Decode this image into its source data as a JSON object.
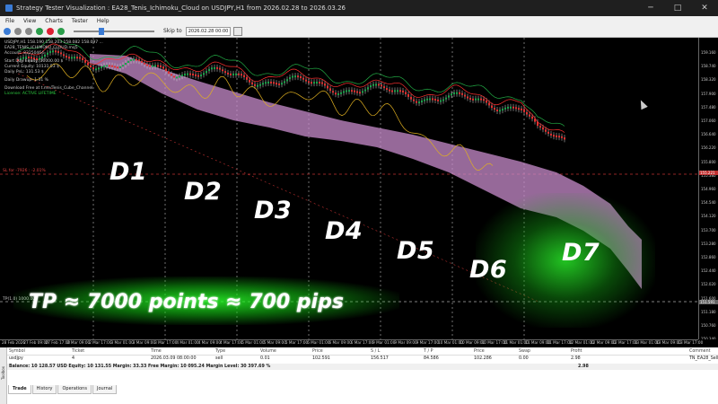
{
  "window": {
    "title": "Strategy Tester Visualization : EA28_Tenis_Ichimoku_Cloud on USDJPY,H1 from 2026.02.28 to 2026.03.26",
    "controls": [
      "─",
      "□",
      "✕"
    ]
  },
  "menu": [
    "File",
    "View",
    "Charts",
    "Tester",
    "Help"
  ],
  "toolbar": {
    "skip_label": "Skip to",
    "skip_date": "2026.02.28 00:00"
  },
  "overlay": {
    "lines": [
      "USDJPY,H1  158.190 158.203 158.082 158.097  ...",
      "EA28_TENIS_ICHIMOKU_CLOUD.mq5",
      "Account: 83250464",
      "",
      "Start Day Equity: 10000.00 $",
      "Current Equity: 10131.53 $",
      "Daily PnL: 131.53 $",
      "",
      "Daily Drawup: 1.31 %",
      "",
      "Download Free at t.me/Tenis_Cube_Channel",
      "License: ACTIVE LIFETIME"
    ],
    "sl_label": "SL for -7926 : -2.01%",
    "tp_line_label": "TP(1.0) 1000.00"
  },
  "price_scale": [
    "159.160",
    "158.740",
    "158.320",
    "157.900",
    "157.480",
    "157.060",
    "156.640",
    "156.220",
    "155.800",
    "155.380",
    "154.960",
    "154.540",
    "154.120",
    "153.700",
    "153.280",
    "152.860",
    "152.440",
    "152.020",
    "151.600",
    "151.180",
    "150.760",
    "150.340"
  ],
  "price_highlight": [
    "155.221",
    "151.591"
  ],
  "time_scale": [
    "28 Feb 2026",
    "27 Feb 09:00",
    "27 Feb 17:00",
    "2 Mar 09:00",
    "2 Mar 17:00",
    "3 Mar 01:00",
    "3 Mar 09:00",
    "3 Mar 17:00",
    "4 Mar 01:00",
    "4 Mar 09:00",
    "4 Mar 17:00",
    "5 Mar 01:00",
    "5 Mar 09:00",
    "5 Mar 17:00",
    "6 Mar 01:00",
    "6 Mar 09:00",
    "6 Mar 17:00",
    "9 Mar 01:00",
    "9 Mar 09:00",
    "9 Mar 17:00",
    "10 Mar 01:00",
    "10 Mar 09:00",
    "10 Mar 17:00",
    "11 Mar 01:00",
    "11 Mar 09:00",
    "11 Mar 17:00",
    "12 Mar 01:00",
    "12 Mar 09:00",
    "12 Mar 17:00",
    "13 Mar 01:00",
    "13 Mar 09:00",
    "13 Mar 17:00"
  ],
  "day_labels": [
    "D1",
    "D2",
    "D3",
    "D4",
    "D5",
    "D6",
    "D7"
  ],
  "headline": "TP ≈ 7000 points ≈ 700 pips",
  "trade_table": {
    "headers": [
      "Symbol",
      "Ticket",
      "Time",
      "Type",
      "Volume",
      "Price",
      "S / L",
      "T / P",
      "Price",
      "Swap",
      "Profit",
      "Comment"
    ],
    "row": [
      "usdjpy",
      "4",
      "2026.03.09 08:00:00",
      "sell",
      "0.01",
      "102.591",
      "156.517",
      "84.586",
      "102.286",
      "0.00",
      "2.98",
      "TN_EA28_Sell"
    ],
    "balance": "Balance: 10 128.57 USD  Equity: 10 131.55  Margin: 33.33  Free Margin: 10 095.24  Margin Level: 30 397.69 %",
    "balance_profit": "2.98"
  },
  "tabs": [
    "Trade",
    "History",
    "Operations",
    "Journal"
  ],
  "toolbox_label": "Toolbox",
  "colors": {
    "cloud": "#c88ccc",
    "bull": "#1aa34a",
    "bear": "#e03030",
    "glow": "#39ff39",
    "tenkan": "#e0b020",
    "kijun": "#ff3030",
    "chikou": "#22aa44"
  }
}
